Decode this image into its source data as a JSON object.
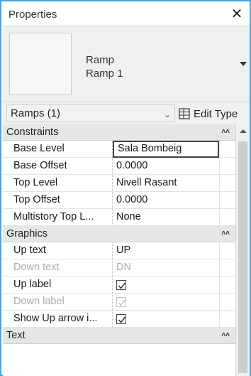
{
  "window": {
    "title": "Properties",
    "close_glyph": "✕"
  },
  "type_selector": {
    "family": "Ramp",
    "type": "Ramp 1"
  },
  "instance": {
    "selector_value": "Ramps (1)",
    "edit_type_label": "Edit Type"
  },
  "groups": {
    "constraints": "Constraints",
    "graphics": "Graphics",
    "text": "Text",
    "collapse_glyph": "⌃"
  },
  "constraints": [
    {
      "label": "Base Level",
      "value": "Sala Bombeig"
    },
    {
      "label": "Base Offset",
      "value": "0.0000"
    },
    {
      "label": "Top Level",
      "value": "Nivell Rasant"
    },
    {
      "label": "Top Offset",
      "value": "0.0000"
    },
    {
      "label": "Multistory Top L...",
      "value": "None"
    }
  ],
  "graphics": [
    {
      "label": "Up text",
      "value": "UP"
    },
    {
      "label": "Down text",
      "value": "DN"
    },
    {
      "label": "Up label",
      "checked": true
    },
    {
      "label": "Down label",
      "checked": true
    },
    {
      "label": "Show Up arrow i...",
      "checked": true
    }
  ],
  "colors": {
    "frame": "#4aa3df",
    "group_bg": "#e6e6e6",
    "disabled_text": "#a9a9a9"
  }
}
